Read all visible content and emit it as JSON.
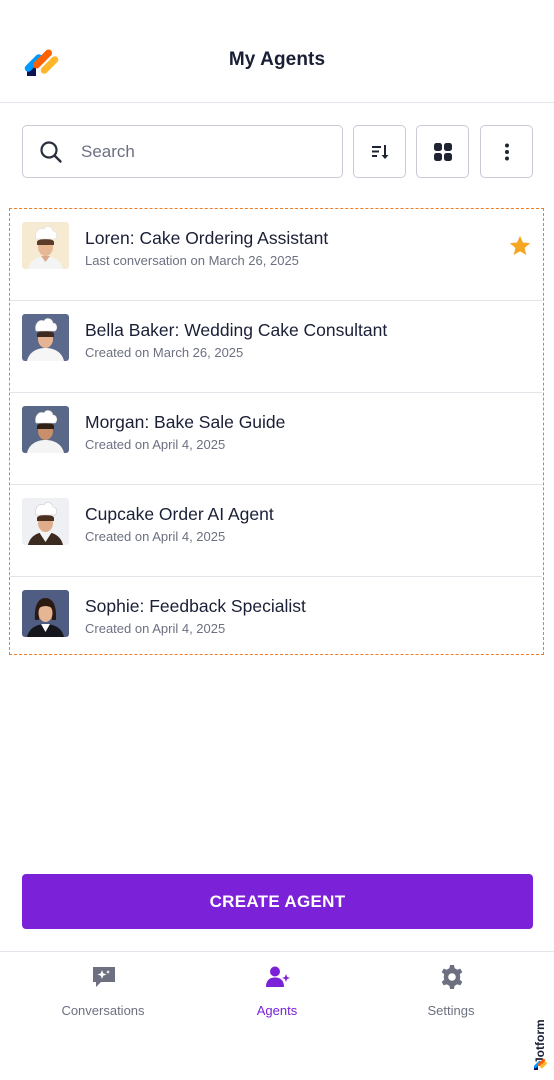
{
  "header": {
    "title": "My Agents",
    "logo_icon": "jotform-logo-icon"
  },
  "toolbar": {
    "search_placeholder": "Search",
    "sort_icon": "sort-icon",
    "grid_icon": "grid-view-icon",
    "more_icon": "more-vertical-icon"
  },
  "agents": [
    {
      "name": "Loren: Cake Ordering Assistant",
      "subtitle": "Last conversation on March 26, 2025",
      "favorite": true,
      "avatar": "chef-woman-avatar"
    },
    {
      "name": "Bella Baker: Wedding Cake Consultant",
      "subtitle": "Created on March 26, 2025",
      "favorite": false,
      "avatar": "chef-woman-avatar"
    },
    {
      "name": "Morgan: Bake Sale Guide",
      "subtitle": "Created on April 4, 2025",
      "favorite": false,
      "avatar": "chef-woman-avatar"
    },
    {
      "name": "Cupcake Order AI Agent",
      "subtitle": "Created on April 4, 2025",
      "favorite": false,
      "avatar": "chef-woman-avatar"
    },
    {
      "name": "Sophie: Feedback Specialist",
      "subtitle": "Created on April 4, 2025",
      "favorite": false,
      "avatar": "businesswoman-avatar"
    }
  ],
  "create_button": {
    "label": "CREATE AGENT"
  },
  "bottom_nav": {
    "items": [
      {
        "label": "Conversations",
        "icon": "chat-sparkle-icon",
        "active": false
      },
      {
        "label": "Agents",
        "icon": "agent-sparkle-icon",
        "active": true
      },
      {
        "label": "Settings",
        "icon": "gear-icon",
        "active": false
      }
    ]
  },
  "brand": {
    "name": "Jotform"
  },
  "colors": {
    "accent": "#7b22d9",
    "star": "#f5a623",
    "highlight_border": "#f07c28"
  }
}
